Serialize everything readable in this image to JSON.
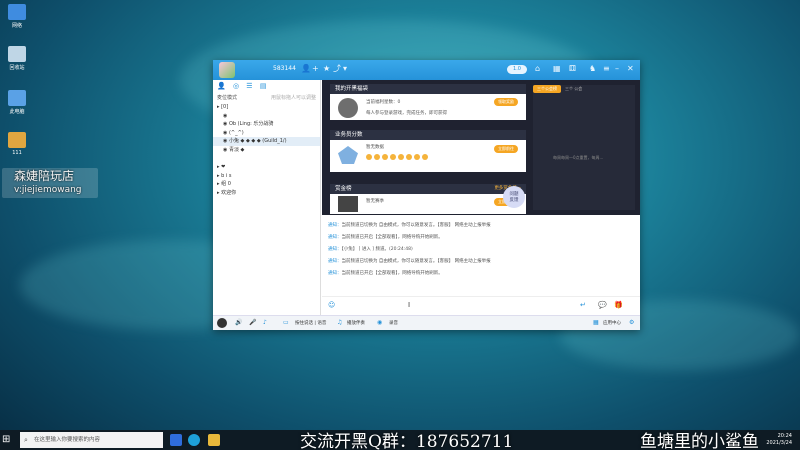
{
  "desktop": {
    "icons": [
      {
        "label": "网络",
        "color": "#3f8ce0"
      },
      {
        "label": "回收站",
        "color": "#bfd6e6"
      },
      {
        "label": "此电脑",
        "color": "#5aa1e6"
      },
      {
        "label": "111",
        "color": "#e0a640"
      }
    ],
    "watermark_tag": {
      "line1": "森婕陪玩店",
      "line2": "v:jiejiemowang"
    }
  },
  "window": {
    "room_id": "583144",
    "titlebar_pill": "1.0"
  },
  "sidebar": {
    "header_left": "麦位模式",
    "header_hint": "用鼠标拖人可以调整",
    "rows": [
      {
        "text": "▸ [0]",
        "indent": false
      },
      {
        "text": "◉",
        "indent": true
      },
      {
        "text": "◉  Ob (Ling: 乐分战骑",
        "indent": true
      },
      {
        "text": "◉  (^_^)",
        "indent": true
      },
      {
        "text": "◉  小兔 ◆ ◆ ◆ ◆ (Guild_1/)",
        "indent": true,
        "highlight": true
      },
      {
        "text": "◉  青淡 ◆",
        "indent": true
      },
      {
        "text": "",
        "indent": true
      },
      {
        "text": "▸ ❤",
        "indent": false
      },
      {
        "text": "▸ b i s",
        "indent": false
      },
      {
        "text": "▸ 组 0",
        "indent": false
      },
      {
        "text": "▸ 欢迎你",
        "indent": false
      }
    ]
  },
  "panels": {
    "p1_title": "我的开黑福袋",
    "p1_text": "当前福利星数：0",
    "p1_text2": "每人参与登录游戏，完成任务，即可获得",
    "p1_btn": "领取奖励",
    "p2_title": "业务员分数",
    "p2_text": "暂无数据",
    "p2_btn": "立即前往",
    "p3_title": "赏金榜",
    "p3_text": "暂无赛季",
    "p3_right": "更多赏金榜 »",
    "p3_btn": "立即前往"
  },
  "right_panel": {
    "tab_active": "三个公会榜",
    "tab_other": "三个 公会",
    "note": "每周每周一0点重置，每周..."
  },
  "float_button": "问题\n反馈",
  "chat": {
    "messages": [
      {
        "tag": "通知：",
        "text": "当前频道已切换为 自由模式，你可以随意发言。【客服】 网络主动上报举报"
      },
      {
        "tag": "通知：",
        "text": "当前频道已开启【全部观看】，网络导购开始刷新。"
      },
      {
        "tag": "通知：",
        "text": "【小兔】  [ 进入 ] 频道。(20:24:48)"
      },
      {
        "tag": "通知：",
        "text": "当前频道已切换为 自由模式，你可以随意发言。【客服】 网络主动上报举报"
      },
      {
        "tag": "通知：",
        "text": "当前频道已开启【全部观看】，网络导购开始刷新。"
      }
    ]
  },
  "bottombar": {
    "label1": "按住说话 | 语音",
    "label2": "播放伴奏",
    "label3": "录音",
    "label4": "应用中心"
  },
  "taskbar": {
    "search_placeholder": "在这里输入你要搜索的内容",
    "clock_time": "20:24",
    "clock_date": "2021/3/24"
  },
  "overlay": {
    "left": "交流开黑Q群：187652711",
    "right": "鱼塘里的小鲨鱼"
  }
}
